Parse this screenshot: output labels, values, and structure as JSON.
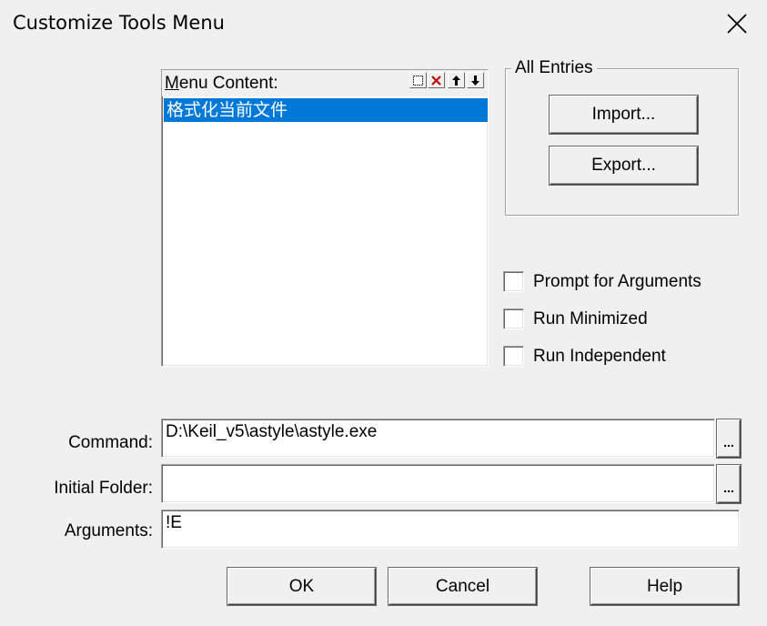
{
  "window": {
    "title": "Customize Tools Menu",
    "close_icon": "close-icon"
  },
  "menu_content": {
    "label_prefix": "M",
    "label_rest": "enu Content:",
    "toolbar_icons": [
      "new-item-icon",
      "delete-icon",
      "move-up-icon",
      "move-down-icon"
    ],
    "items": [
      {
        "label": "格式化当前文件",
        "selected": true
      }
    ]
  },
  "all_entries": {
    "title": "All Entries",
    "import_label": "Import...",
    "export_label": "Export..."
  },
  "options": [
    {
      "label": "Prompt for  Arguments",
      "checked": false
    },
    {
      "label": "Run Minimized",
      "checked": false
    },
    {
      "label": "Run Independent",
      "checked": false
    }
  ],
  "fields": {
    "command": {
      "label": "Command:",
      "value": "D:\\Keil_v5\\astyle\\astyle.exe",
      "browse": "..."
    },
    "initial_folder": {
      "label": "Initial Folder:",
      "value": "",
      "browse": "..."
    },
    "arguments": {
      "label": "Arguments:",
      "value": "!E"
    }
  },
  "buttons": {
    "ok": "OK",
    "cancel": "Cancel",
    "help": "Help"
  },
  "colors": {
    "selection": "#0078d7",
    "dialog_bg": "#f0f0f0"
  }
}
